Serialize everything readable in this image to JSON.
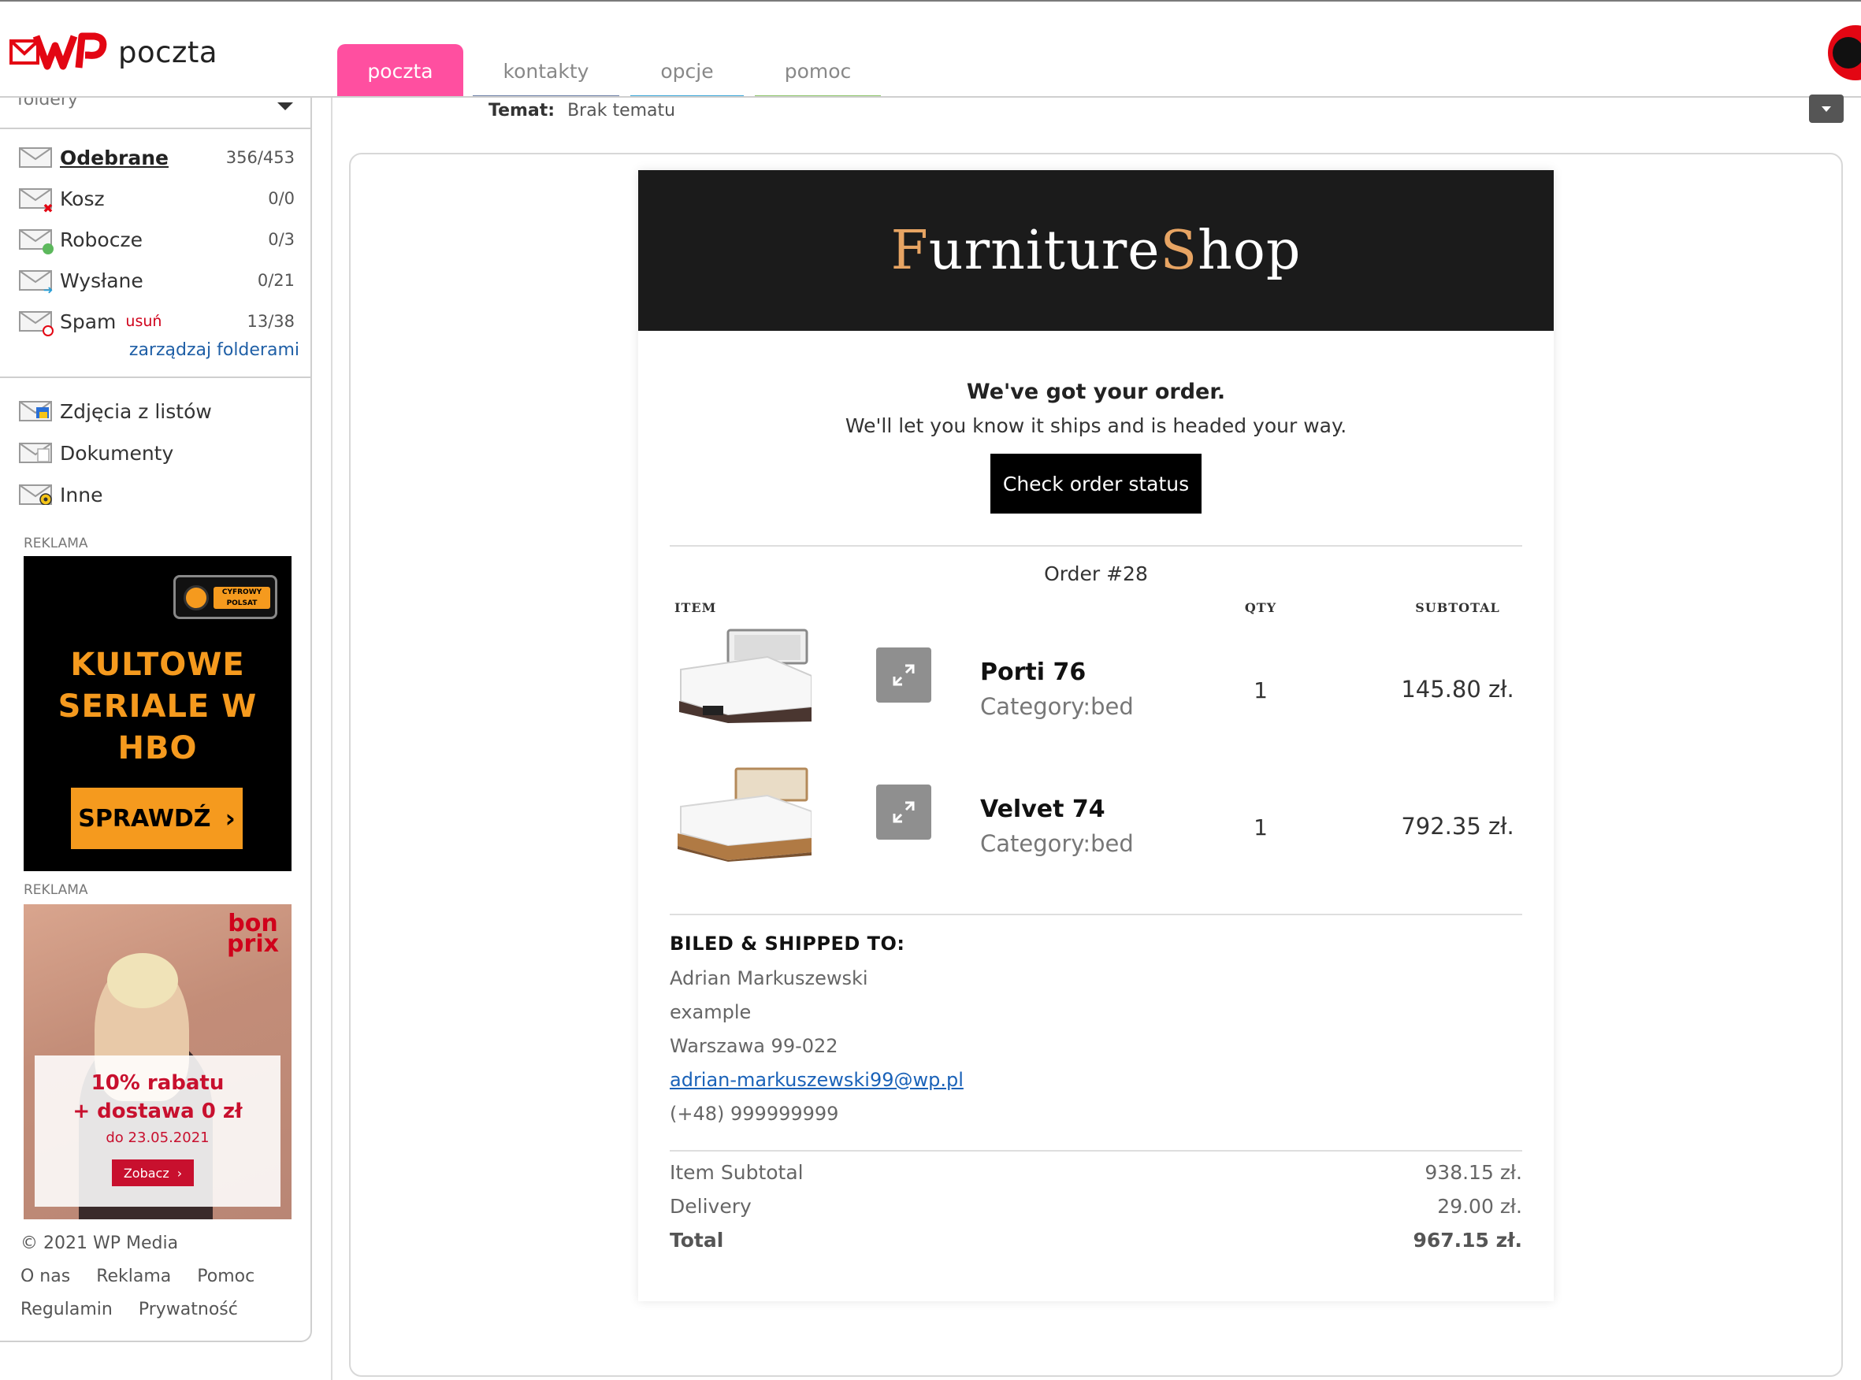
{
  "header": {
    "logo_text": "poczta",
    "tabs": [
      {
        "label": "poczta",
        "active": true,
        "color": "#ff4fa0"
      },
      {
        "label": "kontakty",
        "color": "#6c7fa6"
      },
      {
        "label": "opcje",
        "color": "#3aa6d8"
      },
      {
        "label": "pomoc",
        "color": "#8dc56a"
      }
    ]
  },
  "sidebar": {
    "folders_label": "foldery",
    "folders": [
      {
        "label": "Odebrane",
        "count": "356/453",
        "icon": "envelope-icon"
      },
      {
        "label": "Kosz",
        "count": "0/0",
        "icon": "trash-envelope-icon"
      },
      {
        "label": "Robocze",
        "count": "0/3",
        "icon": "draft-envelope-icon"
      },
      {
        "label": "Wysłane",
        "count": "0/21",
        "icon": "sent-envelope-icon"
      },
      {
        "label": "Spam",
        "count": "13/38",
        "icon": "spam-envelope-icon",
        "action": "usuń"
      }
    ],
    "manage_label": "zarządzaj folderami",
    "smart_folders": [
      {
        "label": "Zdjęcia z listów",
        "icon": "photo-envelope-icon"
      },
      {
        "label": "Dokumenty",
        "icon": "document-envelope-icon"
      },
      {
        "label": "Inne",
        "icon": "other-envelope-icon"
      }
    ],
    "ads": [
      {
        "label": "REKLAMA",
        "logo": "CYFROWY POLSAT",
        "headline": "KULTOWE SERIALE W HBO",
        "cta": "SPRAWDŹ"
      },
      {
        "label": "REKLAMA",
        "brand": "bon prix",
        "line1": "10% rabatu",
        "line2": "+ dostawa 0 zł",
        "line3": "do 23.05.2021",
        "cta": "Zobacz"
      }
    ],
    "footer": {
      "copyright": "© 2021 WP Media",
      "links_row1": [
        "O nas",
        "Reklama",
        "Pomoc"
      ],
      "links_row2": [
        "Regulamin",
        "Prywatność"
      ]
    }
  },
  "message": {
    "subject_label": "Temat:",
    "subject_value": "Brak tematu"
  },
  "email": {
    "brand_part1_initial": "F",
    "brand_part1_rest": "urniture",
    "brand_part2_initial": "S",
    "brand_part2_rest": "hop",
    "brand_accent": "#e7a463",
    "title": "We've got your order.",
    "subtitle": "We'll let you know it ships and is headed your way.",
    "status_button": "Check order status",
    "order_no": "Order #28",
    "columns": {
      "item": "ITEM",
      "qty": "QTY",
      "subtotal": "SUBTOTAL"
    },
    "items": [
      {
        "name": "Porti 76",
        "category": "Category:bed",
        "qty": "1",
        "subtotal": "145.80 zł."
      },
      {
        "name": "Velvet 74",
        "category": "Category:bed",
        "qty": "1",
        "subtotal": "792.35 zł."
      }
    ],
    "shipping": {
      "heading": "BILED & SHIPPED TO:",
      "name": "Adrian Markuszewski",
      "line2": "example",
      "city": "Warszawa 99-022",
      "email": "adrian-markuszewski99@wp.pl",
      "phone": "(+48) 999999999"
    },
    "totals": [
      {
        "label": "Item Subtotal",
        "value": "938.15 zł."
      },
      {
        "label": "Delivery",
        "value": "29.00 zł."
      },
      {
        "label": "Total",
        "value": "967.15 zł."
      }
    ]
  }
}
